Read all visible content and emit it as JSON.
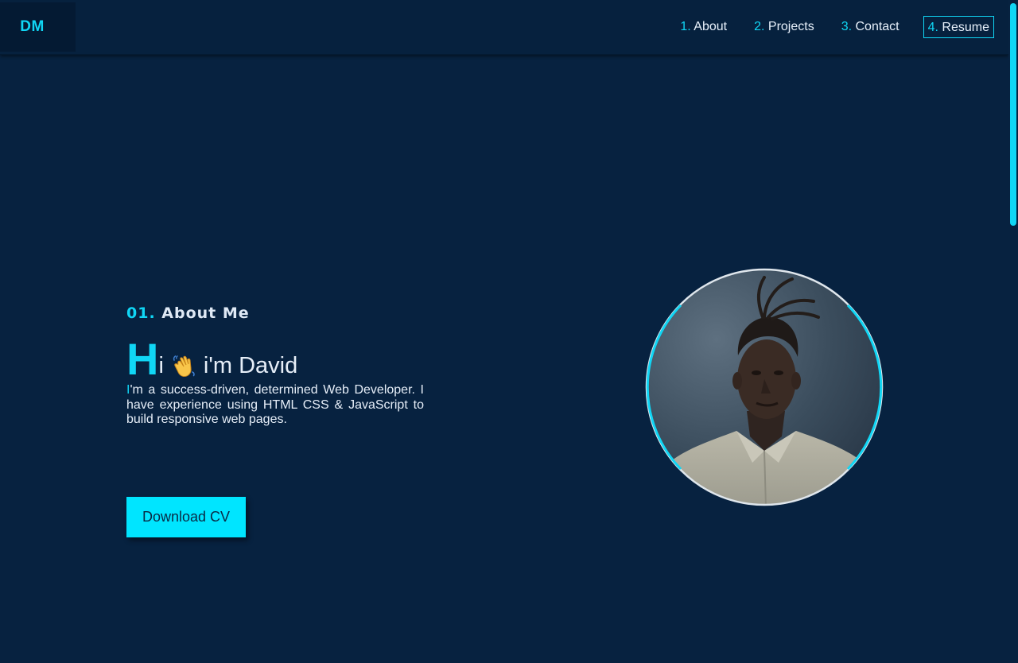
{
  "brand": {
    "logo": "DM"
  },
  "nav": {
    "items": [
      {
        "num": "1.",
        "label": "About"
      },
      {
        "num": "2.",
        "label": "Projects"
      },
      {
        "num": "3.",
        "label": "Contact"
      },
      {
        "num": "4.",
        "label": "Resume"
      }
    ]
  },
  "about": {
    "section_num": "01.",
    "section_title": "About Me",
    "greeting_first": "H",
    "greeting_rest_a": "i",
    "greeting_rest_b": "i'm David",
    "bio_first": "I",
    "bio_rest": "'m a success-driven, determined Web Developer. I have experience using HTML CSS & JavaScript to build responsive web pages.",
    "cta_label": "Download CV"
  },
  "icons": {
    "wave": "waving-hand-icon",
    "avatar": "profile-photo"
  },
  "colors": {
    "background": "#072240",
    "navbar": "#06213e",
    "accent": "#10d6f5",
    "button": "#00e5ff",
    "text": "#e6eef8"
  }
}
